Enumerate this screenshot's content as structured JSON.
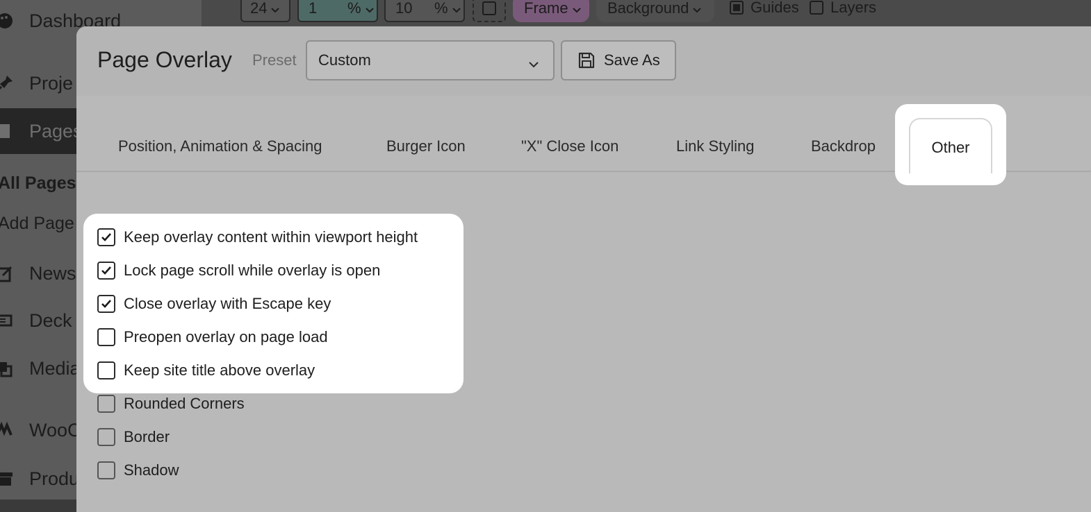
{
  "wp_sidebar": {
    "items": [
      {
        "label": "Dashboard",
        "icon": "palette-icon"
      },
      {
        "label": "Proje",
        "icon": "pin-icon"
      },
      {
        "label": "Pages",
        "icon": "pages-icon"
      },
      {
        "label": "News",
        "icon": "edit-icon"
      },
      {
        "label": "Deck",
        "icon": "deck-icon"
      },
      {
        "label": "Media",
        "icon": "media-icon"
      },
      {
        "label": "WooC",
        "icon": "woo-icon"
      },
      {
        "label": "Produ",
        "icon": "archive-icon"
      }
    ],
    "sub_items": [
      "All Pages",
      "Add Page"
    ]
  },
  "topbar": {
    "size_value": "24",
    "num1": "1",
    "unit1": "%",
    "num2": "10",
    "unit2": "%",
    "frame_label": "Frame",
    "background_label": "Background",
    "guides_label": "Guides",
    "layers_label": "Layers"
  },
  "modal": {
    "title": "Page Overlay",
    "preset_label": "Preset",
    "preset_value": "Custom",
    "save_as_label": "Save As",
    "tabs": [
      {
        "label": "Position, Animation & Spacing"
      },
      {
        "label": "Burger Icon"
      },
      {
        "label": "\"X\" Close Icon"
      },
      {
        "label": "Link Styling"
      },
      {
        "label": "Backdrop"
      },
      {
        "label": "Other"
      }
    ],
    "options": [
      {
        "label": "Keep overlay content within viewport height",
        "checked": true
      },
      {
        "label": "Lock page scroll while overlay is open",
        "checked": true
      },
      {
        "label": "Close overlay with Escape key",
        "checked": true
      },
      {
        "label": "Preopen overlay on page load",
        "checked": false
      },
      {
        "label": "Keep site title above overlay",
        "checked": false
      },
      {
        "label": "Rounded Corners",
        "checked": false
      },
      {
        "label": "Border",
        "checked": false
      },
      {
        "label": "Shadow",
        "checked": false
      }
    ]
  },
  "colors": {
    "highlight": "#ffffff",
    "modal_bg": "#b9b9b9",
    "frame_chip": "#7a5a7a"
  }
}
